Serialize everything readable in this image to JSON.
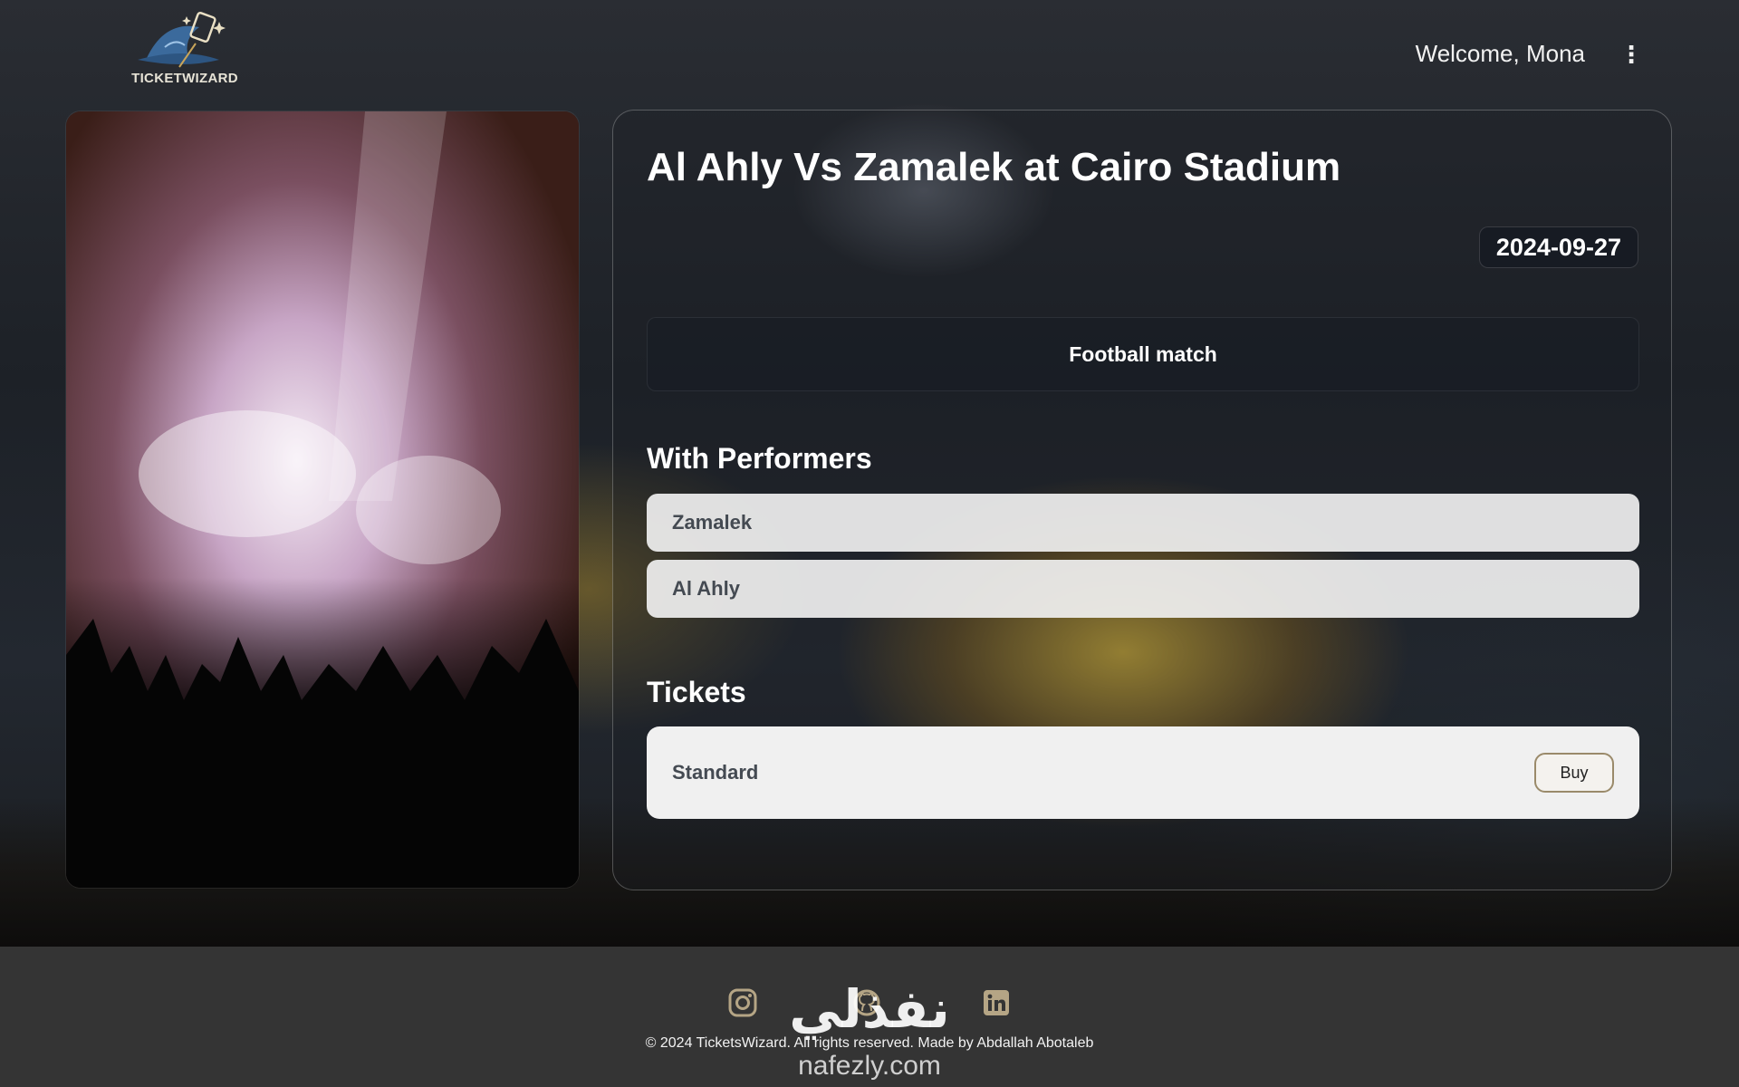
{
  "header": {
    "logo_text": "TICKETWIZARD",
    "welcome_text": "Welcome, Mona",
    "menu_icon": "kebab-menu-icon"
  },
  "event": {
    "title": "Al Ahly Vs Zamalek at Cairo Stadium",
    "date": "2024-09-27",
    "category": "Football match",
    "performers_heading": "With Performers",
    "performers": [
      "Zamalek",
      "Al Ahly"
    ],
    "tickets_heading": "Tickets",
    "tickets": [
      {
        "name": "Standard",
        "action_label": "Buy"
      }
    ]
  },
  "footer": {
    "social_icons": [
      "instagram-icon",
      "github-icon",
      "linkedin-icon"
    ],
    "copyright": "© 2024 TicketsWizard. All rights reserved. Made by Abdallah Abotaleb"
  },
  "watermark": {
    "arabic": "نفذلي",
    "url": "nafezly.com"
  },
  "colors": {
    "footer_bg": "#343434",
    "accent": "#b5a585",
    "card_bg": "#f0f0f0"
  }
}
